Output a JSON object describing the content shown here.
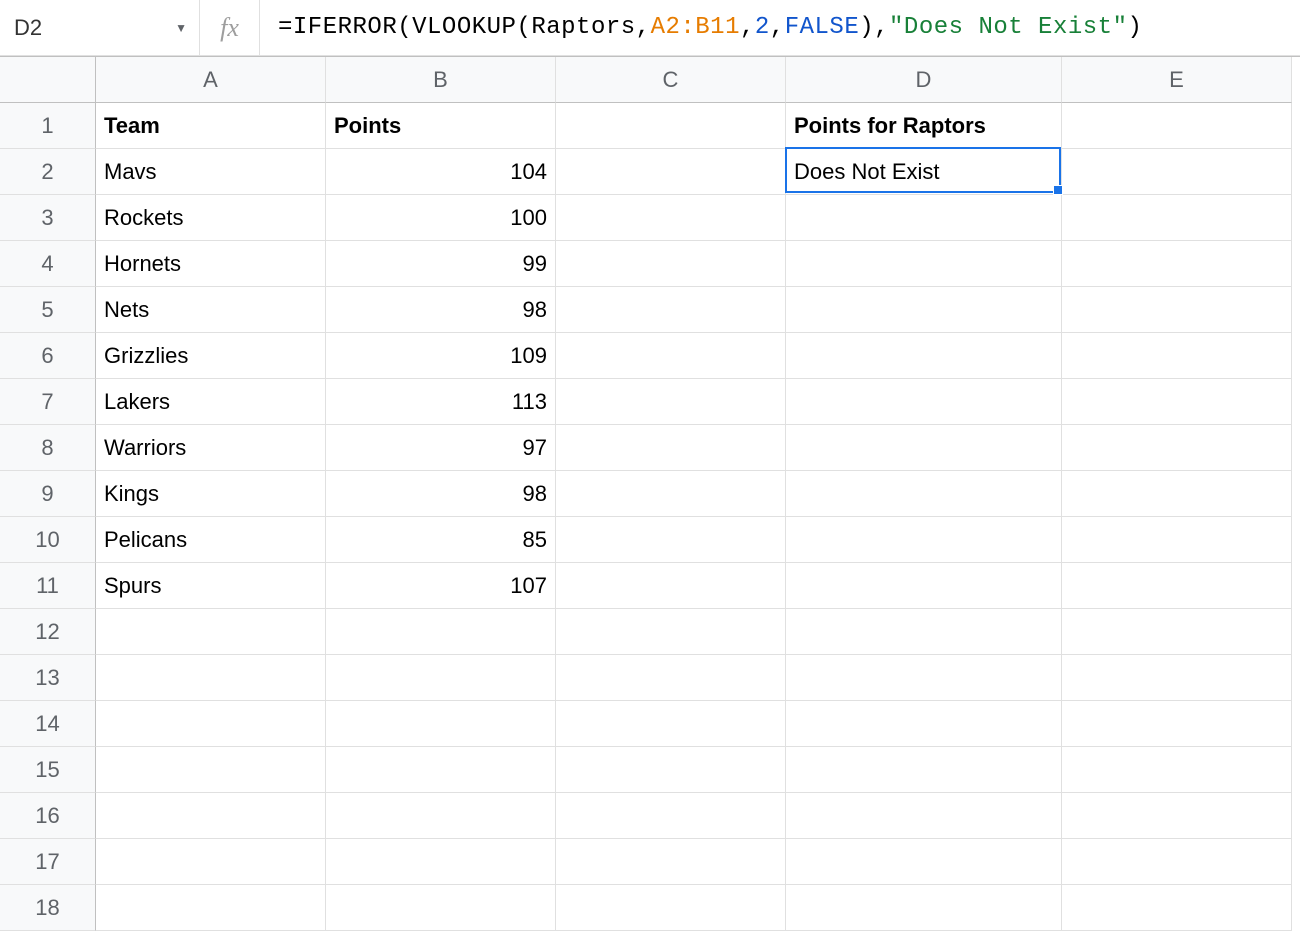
{
  "nameBox": "D2",
  "formula": {
    "prefix": "=IFERROR(VLOOKUP(Raptors,",
    "range": "A2:B11",
    "comma1": ",",
    "num": "2",
    "comma2": ",",
    "bool": "FALSE",
    "mid": "),",
    "str": "\"Does Not Exist\"",
    "suffix": ")"
  },
  "columns": [
    "A",
    "B",
    "C",
    "D",
    "E"
  ],
  "rowCount": 18,
  "headers": {
    "A": "Team",
    "B": "Points",
    "D": "Points for Raptors"
  },
  "data": {
    "teams": [
      "Mavs",
      "Rockets",
      "Hornets",
      "Nets",
      "Grizzlies",
      "Lakers",
      "Warriors",
      "Kings",
      "Pelicans",
      "Spurs"
    ],
    "points": [
      104,
      100,
      99,
      98,
      109,
      113,
      97,
      98,
      85,
      107
    ]
  },
  "selectedCell": {
    "ref": "D2",
    "value": "Does Not Exist"
  }
}
